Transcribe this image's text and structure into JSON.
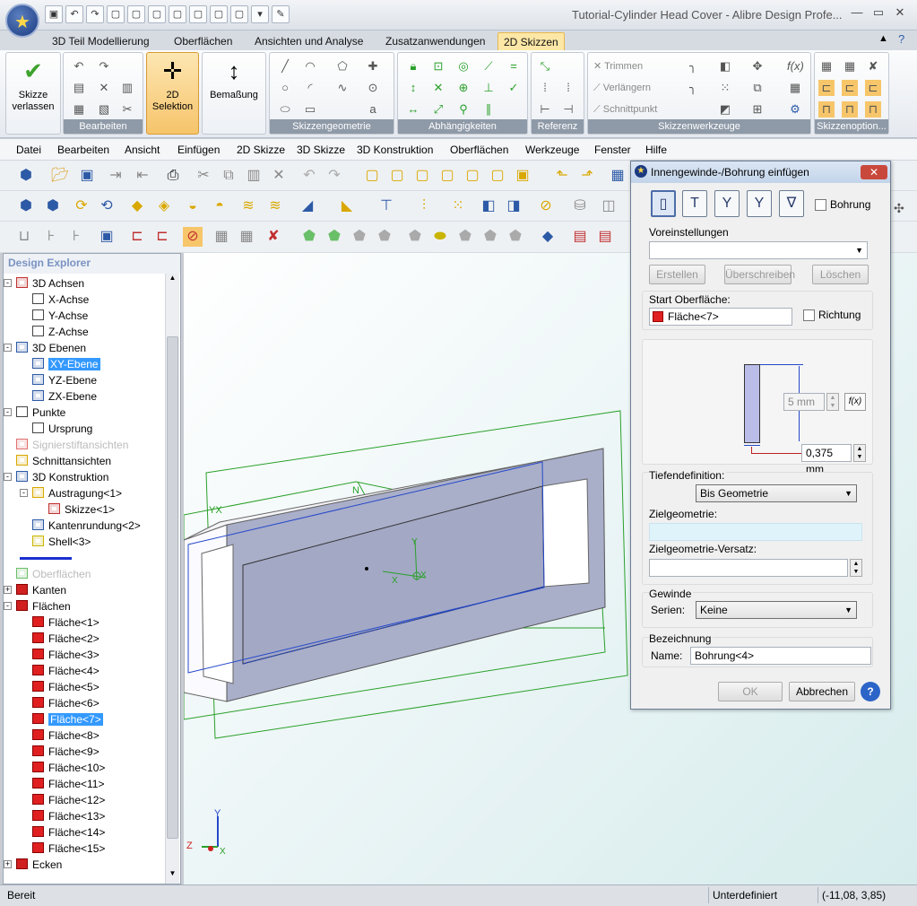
{
  "window": {
    "title": "Tutorial-Cylinder Head Cover - Alibre Design Profe...",
    "min_icon": "minimize-icon",
    "max_icon": "maximize-icon",
    "close_icon": "close-icon"
  },
  "ribbon_tabs": [
    "3D Teil Modellierung",
    "Oberflächen",
    "Ansichten und Analyse",
    "Zusatzanwendungen",
    "2D Skizzen"
  ],
  "ribbon": {
    "groups": {
      "bearbeiten_title": "Bearbeiten",
      "skizzengeometrie_title": "Skizzengeometrie",
      "abhaengigkeiten_title": "Abhängigkeiten",
      "referenz_title": "Referenz",
      "skizzenwerkzeuge_title": "Skizzenwerkzeuge",
      "skizzenoptionen_title": "Skizzenoption..."
    },
    "exit_sketch_label": "Skizze verlassen",
    "selection_label": "2D Selektion",
    "dimension_label": "Bemaßung",
    "trim_label": "Trimmen",
    "extend_label": "Verlängern",
    "intersect_label": "Schnittpunkt"
  },
  "menu": [
    "Datei",
    "Bearbeiten",
    "Ansicht",
    "Einfügen",
    "2D Skizze",
    "3D Skizze",
    "3D Konstruktion",
    "Oberflächen",
    "Werkzeuge",
    "Fenster",
    "Hilfe"
  ],
  "explorer": {
    "title": "Design Explorer",
    "items": [
      {
        "label": "3D Achsen",
        "depth": 0,
        "expander": "-",
        "icon": "axes-icon"
      },
      {
        "label": "X-Achse",
        "depth": 1,
        "expander": "",
        "icon": "axis-icon"
      },
      {
        "label": "Y-Achse",
        "depth": 1,
        "expander": "",
        "icon": "axis-icon"
      },
      {
        "label": "Z-Achse",
        "depth": 1,
        "expander": "",
        "icon": "axis-icon"
      },
      {
        "label": "3D Ebenen",
        "depth": 0,
        "expander": "-",
        "icon": "planes-icon"
      },
      {
        "label": "XY-Ebene",
        "depth": 1,
        "expander": "",
        "icon": "plane-icon",
        "selected": true
      },
      {
        "label": "YZ-Ebene",
        "depth": 1,
        "expander": "",
        "icon": "plane-icon"
      },
      {
        "label": "ZX-Ebene",
        "depth": 1,
        "expander": "",
        "icon": "plane-icon"
      },
      {
        "label": "Punkte",
        "depth": 0,
        "expander": "-",
        "icon": "points-icon"
      },
      {
        "label": "Ursprung",
        "depth": 1,
        "expander": "",
        "icon": "origin-icon"
      },
      {
        "label": "Signierstiftansichten",
        "depth": 0,
        "expander": "",
        "icon": "pen-icon",
        "dim": true
      },
      {
        "label": "Schnittansichten",
        "depth": 0,
        "expander": "",
        "icon": "section-icon"
      },
      {
        "label": "3D Konstruktion",
        "depth": 0,
        "expander": "-",
        "icon": "construction-icon"
      },
      {
        "label": "Austragung<1>",
        "depth": 1,
        "expander": "-",
        "icon": "extrude-icon"
      },
      {
        "label": "Skizze<1>",
        "depth": 2,
        "expander": "",
        "icon": "sketch-icon"
      },
      {
        "label": "Kantenrundung<2>",
        "depth": 1,
        "expander": "",
        "icon": "fillet-icon"
      },
      {
        "label": "Shell<3>",
        "depth": 1,
        "expander": "",
        "icon": "shell-icon"
      },
      {
        "label": "",
        "depth": 0,
        "expander": "",
        "icon": "rollback-bar-icon"
      },
      {
        "label": "Oberflächen",
        "depth": 0,
        "expander": "",
        "icon": "surfaces-icon",
        "dim": true
      },
      {
        "label": "Kanten",
        "depth": 0,
        "expander": "+",
        "icon": "edges-icon"
      },
      {
        "label": "Flächen",
        "depth": 0,
        "expander": "-",
        "icon": "faces-icon"
      },
      {
        "label": "Fläche<1>",
        "depth": 1,
        "expander": "",
        "icon": "face-icon"
      },
      {
        "label": "Fläche<2>",
        "depth": 1,
        "expander": "",
        "icon": "face-icon"
      },
      {
        "label": "Fläche<3>",
        "depth": 1,
        "expander": "",
        "icon": "face-icon"
      },
      {
        "label": "Fläche<4>",
        "depth": 1,
        "expander": "",
        "icon": "face-icon"
      },
      {
        "label": "Fläche<5>",
        "depth": 1,
        "expander": "",
        "icon": "face-icon"
      },
      {
        "label": "Fläche<6>",
        "depth": 1,
        "expander": "",
        "icon": "face-icon"
      },
      {
        "label": "Fläche<7>",
        "depth": 1,
        "expander": "",
        "icon": "face-icon",
        "selected": true
      },
      {
        "label": "Fläche<8>",
        "depth": 1,
        "expander": "",
        "icon": "face-icon"
      },
      {
        "label": "Fläche<9>",
        "depth": 1,
        "expander": "",
        "icon": "face-icon"
      },
      {
        "label": "Fläche<10>",
        "depth": 1,
        "expander": "",
        "icon": "face-icon"
      },
      {
        "label": "Fläche<11>",
        "depth": 1,
        "expander": "",
        "icon": "face-icon"
      },
      {
        "label": "Fläche<12>",
        "depth": 1,
        "expander": "",
        "icon": "face-icon"
      },
      {
        "label": "Fläche<13>",
        "depth": 1,
        "expander": "",
        "icon": "face-icon"
      },
      {
        "label": "Fläche<14>",
        "depth": 1,
        "expander": "",
        "icon": "face-icon"
      },
      {
        "label": "Fläche<15>",
        "depth": 1,
        "expander": "",
        "icon": "face-icon"
      },
      {
        "label": "Ecken",
        "depth": 0,
        "expander": "+",
        "icon": "vertices-icon"
      }
    ]
  },
  "viewport": {
    "axis_labels": {
      "yx": "YX",
      "y": "Y",
      "x": "X",
      "z": "Z",
      "x_small": "X",
      "y_small": "Y",
      "x2": "X"
    }
  },
  "dialog": {
    "title": "Innengewinde-/Bohrung einfügen",
    "bohrung_label": "Bohrung",
    "voreinstellungen_label": "Voreinstellungen",
    "voreinstellungen_value": "",
    "erstellen": "Erstellen",
    "ueberschreiben": "Überschreiben",
    "loeschen": "Löschen",
    "start_label": "Start Oberfläche:",
    "start_value": "Fläche<7>",
    "richtung_label": "Richtung",
    "depth_value": "5 mm",
    "diameter_value": "0,375 mm",
    "fx_label": "f(x)",
    "tiefen_label": "Tiefendefinition:",
    "tiefen_value": "Bis Geometrie",
    "ziel_label": "Zielgeometrie:",
    "ziel_value": "",
    "versatz_label": "Zielgeometrie-Versatz:",
    "versatz_value": "",
    "gewinde_label": "Gewinde",
    "serien_label": "Serien:",
    "serien_value": "Keine",
    "bezeichnung_label": "Bezeichnung",
    "name_label": "Name:",
    "name_value": "Bohrung<4>",
    "ok": "OK",
    "abbrechen": "Abbrechen",
    "help_icon": "help-icon"
  },
  "status": {
    "left": "Bereit",
    "middle": "Unterdefiniert",
    "coords": "(-11,08, 3,85)"
  },
  "colors": {
    "accent": "#3399ff",
    "selection_orange": "#f7c66a",
    "sketch_green": "#2aa02a",
    "part_face": "#a9aec9"
  }
}
